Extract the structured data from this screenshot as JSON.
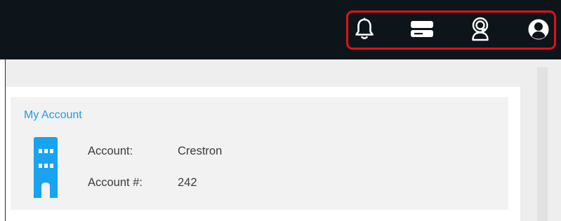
{
  "header": {
    "icons": [
      "bell-icon",
      "server-icon",
      "support-headset-icon",
      "user-account-icon"
    ],
    "icon_color": "#ffffff",
    "background_color": "#0d151b",
    "highlight_color": "#e0101b"
  },
  "account_card": {
    "title": "My Account",
    "icon": "building-icon",
    "icon_color": "#1aa3f0",
    "fields": [
      {
        "label": "Account:",
        "value": "Crestron"
      },
      {
        "label": "Account #:",
        "value": "242"
      }
    ]
  }
}
